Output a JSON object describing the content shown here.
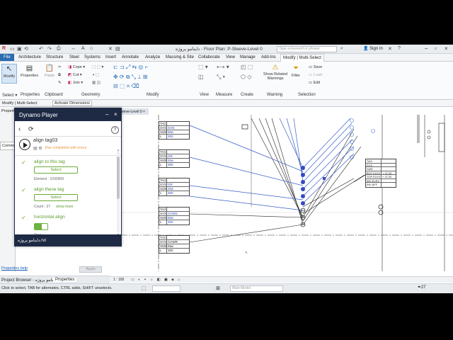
{
  "titlebar": {
    "title": "Floor Plan: P-Sleeve-Level 0",
    "project": "داینامو پروژه",
    "search_placeholder": "Type a keyword or phrase",
    "sign_in": "Sign In"
  },
  "ribbon_tabs": [
    "File",
    "Architecture",
    "Structure",
    "Steel",
    "Systems",
    "Insert",
    "Annotate",
    "Analyze",
    "Massing & Site",
    "Collaborate",
    "View",
    "Manage",
    "Add-Ins",
    "Modify | Multi-Select"
  ],
  "ribbon": {
    "modify": "Modify",
    "properties": "Properties",
    "paste": "Paste",
    "cope": "Cope",
    "cut": "Cut",
    "join": "Join",
    "show_related": "Show Related Warnings",
    "filter": "Filter",
    "save": "Save",
    "load": "Load",
    "edit": "Edit",
    "panels": [
      "Select",
      "Properties",
      "Clipboard",
      "Geometry",
      "Modify",
      "View",
      "Measure",
      "Create",
      "Warning",
      "Selection"
    ]
  },
  "context": {
    "label": "Modify | Multi-Select",
    "activate": "Activate Dimensions"
  },
  "side": {
    "properties_tab": "Propert",
    "common": "Commo",
    "properties_help": "Properties help",
    "apply": "Apply"
  },
  "view_tab": "eeve-Level 0",
  "dynamo": {
    "title": "Dynamo Player",
    "script_name": "align tag03",
    "status": "Run completed with errors",
    "inputs": [
      {
        "label": "align to this tag",
        "button": "Select",
        "info": "Element : 1032909"
      },
      {
        "label": "align these tag",
        "button": "Select",
        "info": "Count : 27",
        "more": "show more"
      },
      {
        "label": "horizontal align",
        "value": "True"
      }
    ],
    "file": "داینامو پروژه.rvt",
    "help": "?"
  },
  "bottom_tabs": [
    "Project Browser - داینامو پروژه",
    "Properties"
  ],
  "statusbar": {
    "hint": "Click to select, TAB for alternates, CTRL adds, SHIFT unselects.",
    "scale": "1 : 100",
    "model": "Main Model",
    "count": "27"
  },
  "tags": [
    {
      "sys": "SAN",
      "size": "50ø",
      "l": "300"
    },
    {
      "sys": "GR",
      "size": "20ø",
      "l": "300"
    },
    {
      "sys": "GR",
      "size": "20ø",
      "l": "300"
    },
    {
      "sys": "CHWS",
      "size": "65ø",
      "l": "300"
    },
    {
      "sys": "CHWR",
      "size": "65ø",
      "l": "300"
    }
  ],
  "tag_labels": {
    "tag": "TAG",
    "sys": "SYS",
    "size": "SIZE",
    "l": "L"
  },
  "right_tag": [
    "TAG",
    "SYS",
    "SIZE",
    "BOT ELEV",
    "TOP ELEV",
    "INV ELEV",
    "INV AFF"
  ],
  "right_tag_values": [
    "+ 47.00",
    "+ 47.00"
  ]
}
